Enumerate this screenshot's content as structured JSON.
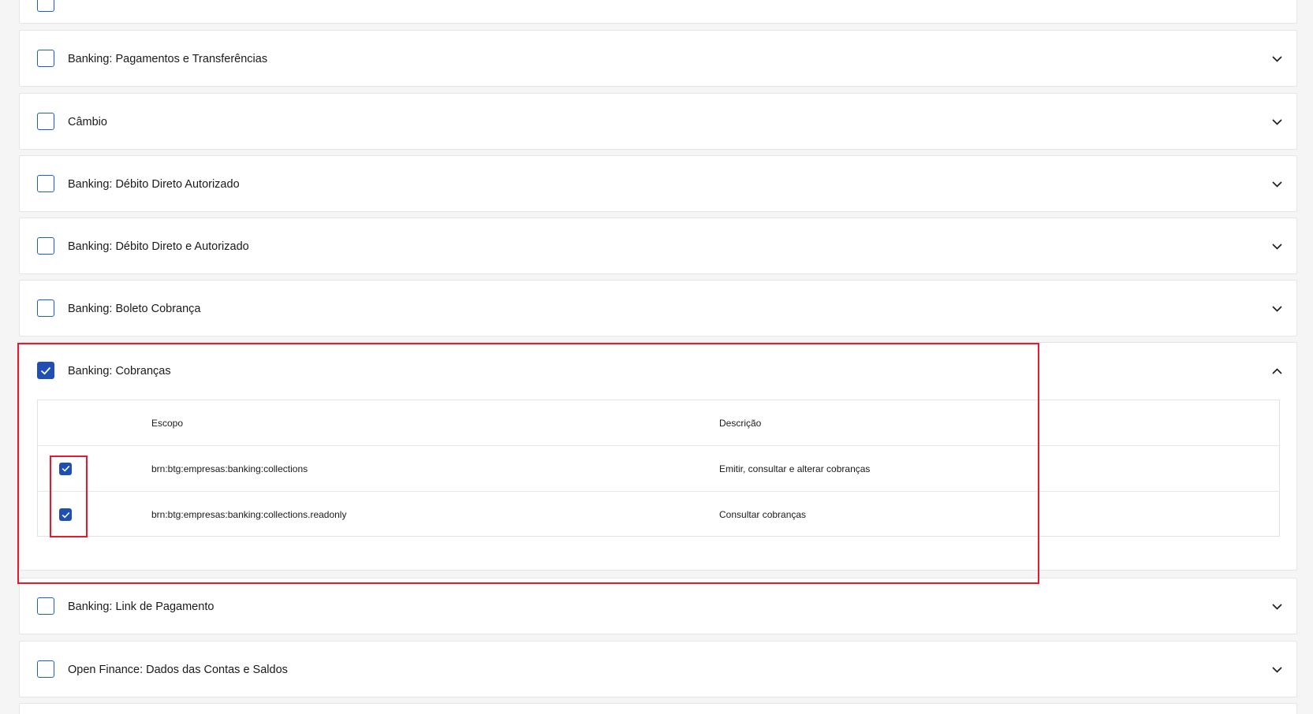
{
  "colors": {
    "accent": "#1f4fb3",
    "annotation": "#e8192c",
    "background": "#f5f5f5"
  },
  "sections": [
    {
      "title": "Banking: Pagamentos e Transferências",
      "checked": false,
      "expanded": false
    },
    {
      "title": "Câmbio",
      "checked": false,
      "expanded": false
    },
    {
      "title": "Banking: Débito Direto Autorizado",
      "checked": false,
      "expanded": false
    },
    {
      "title": "Banking: Débito Direto e Autorizado",
      "checked": false,
      "expanded": false
    },
    {
      "title": "Banking: Boleto Cobrança",
      "checked": false,
      "expanded": false
    },
    {
      "title": "Banking: Cobranças",
      "checked": true,
      "expanded": true,
      "table": {
        "headers": {
          "scope": "Escopo",
          "description": "Descrição"
        },
        "rows": [
          {
            "checked": true,
            "scope": "brn:btg:empresas:banking:collections",
            "description": "Emitir, consultar e alterar cobranças"
          },
          {
            "checked": true,
            "scope": "brn:btg:empresas:banking:collections.readonly",
            "description": "Consultar cobranças"
          }
        ]
      }
    },
    {
      "title": "Banking: Link de Pagamento",
      "checked": false,
      "expanded": false
    },
    {
      "title": "Open Finance: Dados das Contas e Saldos",
      "checked": false,
      "expanded": false
    }
  ],
  "icons": {
    "collapsed": "chevron-down-icon",
    "expanded": "chevron-up-icon",
    "check": "check-icon"
  }
}
